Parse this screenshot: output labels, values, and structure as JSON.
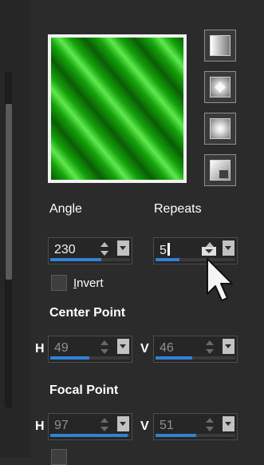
{
  "style_buttons": [
    {
      "name": "linear-style-icon"
    },
    {
      "name": "rectangular-style-icon"
    },
    {
      "name": "radial-style-icon"
    },
    {
      "name": "corner-style-icon"
    }
  ],
  "angle": {
    "label": "Angle",
    "value": "230",
    "level": 0.64
  },
  "repeats": {
    "label": "Repeats",
    "value": "5",
    "level": 0.3
  },
  "invert": {
    "label_prefix": "I",
    "label_rest": "nvert",
    "checked": false
  },
  "center_point": {
    "label": "Center Point",
    "h": {
      "letter": "H",
      "value": "49",
      "level": 0.49
    },
    "v": {
      "letter": "V",
      "value": "46",
      "level": 0.46
    }
  },
  "focal_point": {
    "label": "Focal Point",
    "h": {
      "letter": "H",
      "value": "97",
      "level": 0.97
    },
    "v": {
      "letter": "V",
      "value": "51",
      "level": 0.51
    }
  },
  "colors": {
    "accent": "#2f82d6",
    "panel": "#2b2b2b",
    "field": "#262626"
  }
}
